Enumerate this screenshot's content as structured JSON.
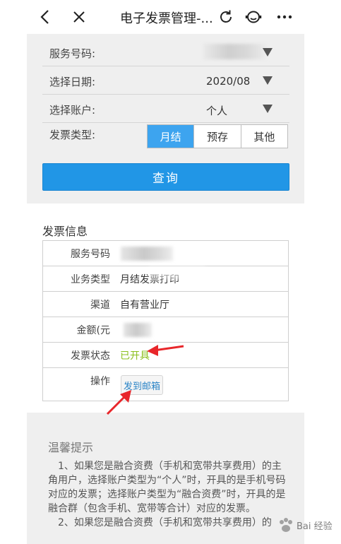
{
  "topbar": {
    "title": "电子发票管理-..."
  },
  "form": {
    "service_number_label": "服务号码:",
    "date_label": "选择日期:",
    "date_value": "2020/08",
    "account_label": "选择账户:",
    "account_value": "个人",
    "invoice_type_label": "发票类型:",
    "invoice_types": [
      "月结",
      "预存",
      "其他"
    ],
    "query_button": "查询"
  },
  "info": {
    "title": "发票信息",
    "rows": [
      {
        "label": "服务号码",
        "value": ""
      },
      {
        "label": "业务类型",
        "value": "月结发票打印"
      },
      {
        "label": "渠道",
        "value": "自有营业厅"
      },
      {
        "label": "金额(元",
        "value": ""
      },
      {
        "label": "发票状态",
        "value": "已开具"
      },
      {
        "label": "操作",
        "value": ""
      }
    ],
    "action_button": "发到邮箱"
  },
  "tips": {
    "title": "温馨提示",
    "paragraph_1": "1、如果您是融合资费（手机和宽带共享费用）的主角用户，选择账户类型为“个人”时，开具的是手机号码对应的发票；选择账户类型为“融合资费”时，开具的是融合群（包含手机、宽带等合计）对应的发票。",
    "paragraph_2": "2、如果您是融合资费（手机和宽带共享费用）的"
  },
  "watermark": {
    "text": "Bai 经验"
  },
  "colors": {
    "accent": "#2196e6",
    "segment_active": "#3da4ef",
    "status_green": "#8bbf1d",
    "arrow_red": "#e8262a"
  }
}
